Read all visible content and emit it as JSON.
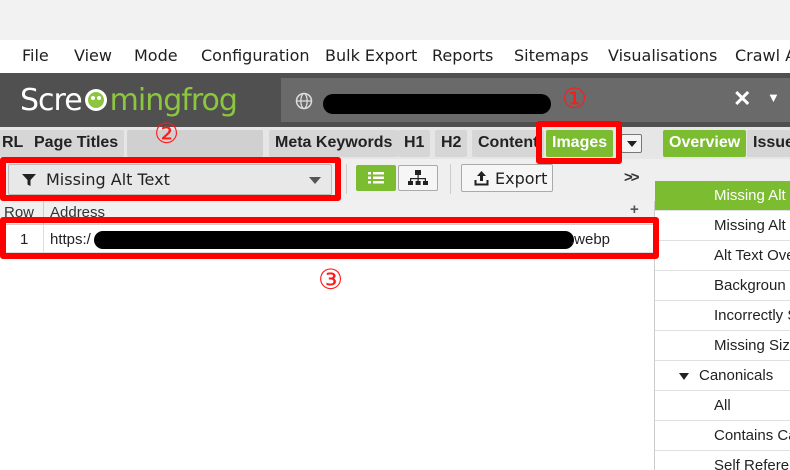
{
  "menu": [
    "File",
    "View",
    "Mode",
    "Configuration",
    "Bulk Export",
    "Reports",
    "Sitemaps",
    "Visualisations",
    "Crawl A"
  ],
  "logo": {
    "part1": "Scre",
    "part2": "ming",
    "part3": "frog"
  },
  "url_bar": {
    "clear_icon": "close-icon",
    "dropdown_icon": "chevron-down-icon"
  },
  "tabs": [
    "RL",
    "Page Titles",
    "Meta Keywords",
    "H1",
    "H2",
    "Content",
    "Images"
  ],
  "right_tabs": [
    "Overview",
    "Issue"
  ],
  "toolbar": {
    "filter_value": "Missing Alt Text",
    "export_label": "Export",
    "collapse_label": ">>"
  },
  "grid": {
    "columns": [
      "Row",
      "Address"
    ],
    "add_column": "+",
    "rows": [
      {
        "row": "1",
        "address_prefix": "https:/",
        "address_suffix": ".webp"
      }
    ]
  },
  "overview_items": [
    {
      "label": "Missing Alt",
      "selected": true
    },
    {
      "label": "Missing Alt"
    },
    {
      "label": "Alt Text Ove"
    },
    {
      "label": "Backgroun"
    },
    {
      "label": "Incorrectly S"
    },
    {
      "label": "Missing Siz"
    },
    {
      "label": "Canonicals",
      "category": true
    },
    {
      "label": "All"
    },
    {
      "label": "Contains Ca"
    },
    {
      "label": "Self Referer"
    }
  ],
  "annotations": [
    "①",
    "②",
    "③"
  ],
  "colors": {
    "accent_green": "#7cbc30",
    "annotation_red": "#ff0000",
    "header_gray": "#505050"
  }
}
